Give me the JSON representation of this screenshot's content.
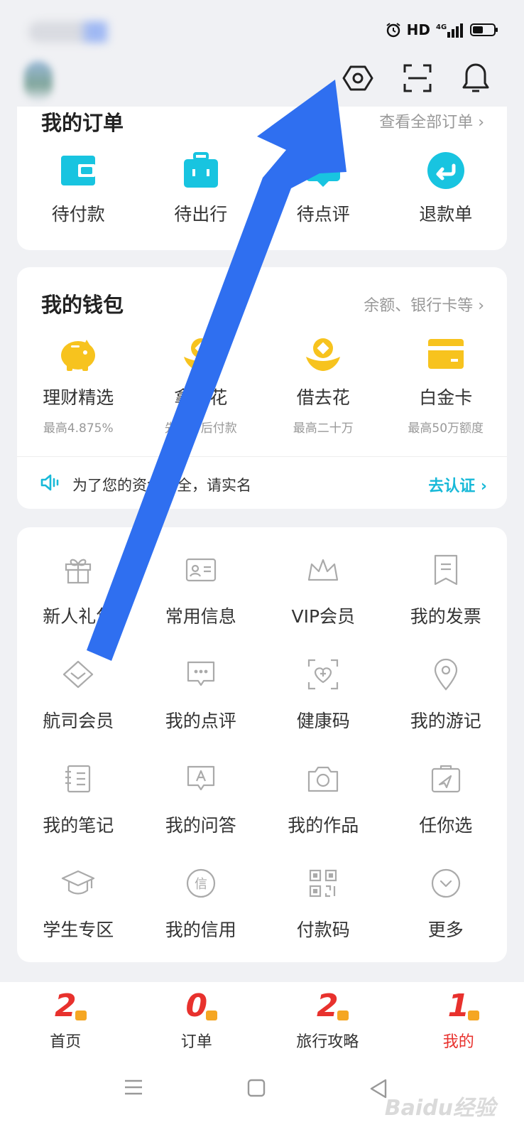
{
  "status": {
    "hd": "HD",
    "network": "4G"
  },
  "orders": {
    "title": "我的订单",
    "view_all": "查看全部订单 ›",
    "items": [
      {
        "label": "待付款",
        "icon": "wallet-icon"
      },
      {
        "label": "待出行",
        "icon": "luggage-icon"
      },
      {
        "label": "待点评",
        "icon": "review-icon"
      },
      {
        "label": "退款单",
        "icon": "refund-icon"
      }
    ]
  },
  "wallet": {
    "title": "我的钱包",
    "link": "余额、银行卡等 ›",
    "items": [
      {
        "label": "理财精选",
        "sub": "最高4.875%",
        "icon": "piggy-bank-icon"
      },
      {
        "label": "拿去花",
        "sub": "先出行后付款",
        "icon": "coin-flower-icon"
      },
      {
        "label": "借去花",
        "sub": "最高二十万",
        "icon": "coin-flower-icon"
      },
      {
        "label": "白金卡",
        "sub": "最高50万额度",
        "icon": "card-icon"
      }
    ],
    "notice_text": "为了您的资金安全，请实名",
    "notice_link": "去认证 ›"
  },
  "tools": {
    "items": [
      {
        "label": "新人礼包",
        "icon": "gift-icon"
      },
      {
        "label": "常用信息",
        "icon": "id-card-icon"
      },
      {
        "label": "VIP会员",
        "icon": "crown-icon"
      },
      {
        "label": "我的发票",
        "icon": "invoice-icon"
      },
      {
        "label": "航司会员",
        "icon": "diamond-icon"
      },
      {
        "label": "我的点评",
        "icon": "comment-icon"
      },
      {
        "label": "健康码",
        "icon": "health-code-icon"
      },
      {
        "label": "我的游记",
        "icon": "location-pin-icon"
      },
      {
        "label": "我的笔记",
        "icon": "notebook-icon"
      },
      {
        "label": "我的问答",
        "icon": "qa-icon"
      },
      {
        "label": "我的作品",
        "icon": "camera-icon"
      },
      {
        "label": "任你选",
        "icon": "travel-pass-icon"
      },
      {
        "label": "学生专区",
        "icon": "graduation-cap-icon"
      },
      {
        "label": "我的信用",
        "icon": "credit-icon"
      },
      {
        "label": "付款码",
        "icon": "qr-code-icon"
      },
      {
        "label": "更多",
        "icon": "more-chevron-icon"
      }
    ]
  },
  "bottom_nav": [
    {
      "label": "首页",
      "num": "2",
      "active": false
    },
    {
      "label": "订单",
      "num": "0",
      "active": false
    },
    {
      "label": "旅行攻略",
      "num": "2",
      "active": false
    },
    {
      "label": "我的",
      "num": "1",
      "active": true
    }
  ],
  "watermark": "Baidu经验",
  "colors": {
    "accent_cyan": "#18c4e0",
    "accent_yellow": "#f7c31e",
    "active_red": "#e8312d",
    "arrow_blue": "#2f6ff0"
  }
}
